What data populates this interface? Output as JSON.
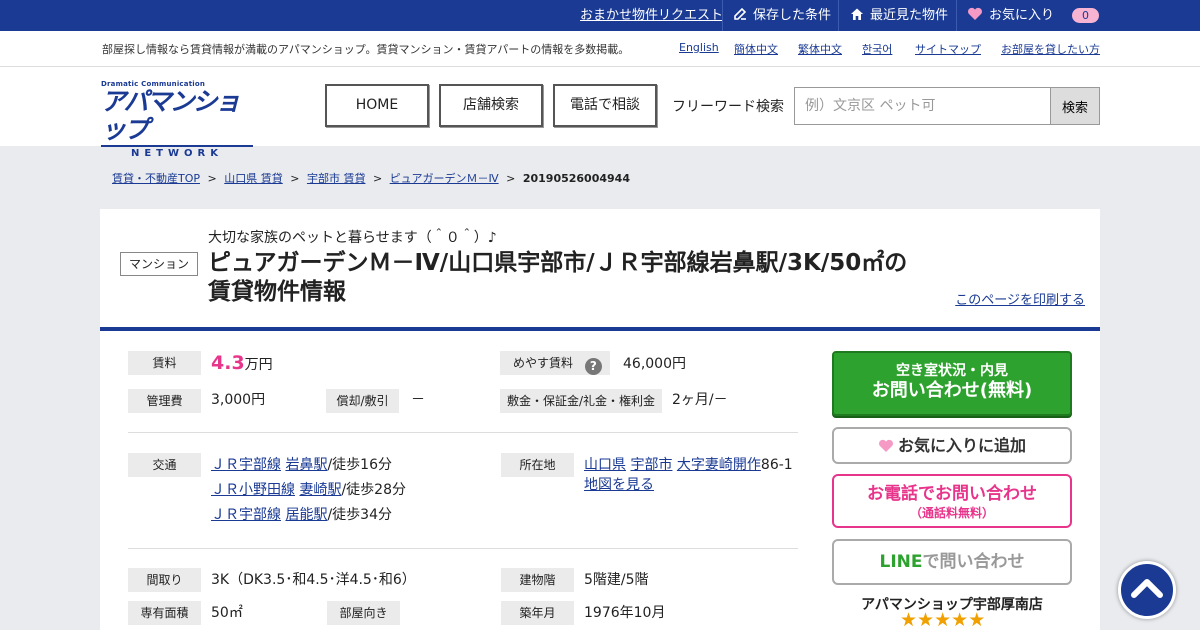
{
  "topbar": {
    "request": "おまかせ物件リクエスト",
    "saved": "保存した条件",
    "recent": "最近見た物件",
    "favorite": "お気に入り",
    "favorite_count": "0"
  },
  "subbar": {
    "tagline": "部屋探し情報なら賃貸情報が満載のアパマンショップ。賃貸マンション・賃貸アパートの情報を多数掲載。",
    "links": [
      "English",
      "簡体中文",
      "繁体中文",
      "한국어",
      "サイトマップ",
      "お部屋を貸したい方"
    ]
  },
  "header": {
    "logo_small": "Dramatic Communication",
    "logo_main": "アパマンショップ",
    "logo_sub": "NETWORK",
    "nav": [
      "HOME",
      "店舗検索",
      "電話で相談"
    ],
    "freeword_label": "フリーワード検索",
    "search_placeholder": "例）文京区 ペット可",
    "search_button": "検索"
  },
  "breadcrumb": [
    "賃貸・不動産TOP",
    "山口県 賃貸",
    "宇部市 賃貸",
    "ピュアガーデンＭ－Ⅳ",
    "20190526004944"
  ],
  "breadcrumb_sep": ">",
  "property": {
    "type_badge": "マンション",
    "catchphrase": "大切な家族のペットと暮らせます（＾０＾）♪",
    "title": "ピュアガーデンＭ－Ⅳ/山口県宇部市/ＪＲ宇部線岩鼻駅/3K/50㎡の賃貸物件情報",
    "print_link": "このページを印刷する",
    "rent_label": "賃料",
    "rent_value": "4.3",
    "rent_unit": "万円",
    "guide_label": "めやす賃料",
    "guide_value": "46,000円",
    "mgmt_label": "管理費",
    "mgmt_value": "3,000円",
    "deposit_label": "償却/敷引",
    "deposit_value": "－",
    "shikikin_label": "敷金・保証金/礼金・権利金",
    "shikikin_value": "2ヶ月/－",
    "transport_label": "交通",
    "transport": [
      {
        "line": "ＪＲ宇部線",
        "station": "岩鼻駅",
        "walk": "/徒歩16分"
      },
      {
        "line": "ＪＲ小野田線",
        "station": "妻崎駅",
        "walk": "/徒歩28分"
      },
      {
        "line": "ＪＲ宇部線",
        "station": "居能駅",
        "walk": "/徒歩34分"
      }
    ],
    "address_label": "所在地",
    "address_pref": "山口県",
    "address_city": "宇部市",
    "address_town": "大字妻崎開作",
    "address_rest": "86-1",
    "map_link": "地図を見る",
    "layout_label": "間取り",
    "layout_value": "3K（DK3.5･和4.5･洋4.5･和6）",
    "floor_label": "建物階",
    "floor_value": "5階建/5階",
    "area_label": "専有面積",
    "area_value": "50㎡",
    "direction_label": "部屋向き",
    "built_label": "築年月",
    "built_value": "1976年10月"
  },
  "cta": {
    "main_line1": "空き室状況・内見",
    "main_line2": "お問い合わせ(無料)",
    "favorite": "お気に入りに追加",
    "tel_line1": "お電話でお問い合わせ",
    "tel_line2": "（通話料無料）",
    "line_brand": "LINE",
    "line_rest": "で問い合わせ",
    "shop_name": "アパマンショップ宇部厚南店",
    "rating": 5
  },
  "colors": {
    "brand_blue": "#1a3a94",
    "rent_pink": "#e8358c",
    "cta_green": "#2ea22e",
    "star_gold": "#f0a000"
  }
}
